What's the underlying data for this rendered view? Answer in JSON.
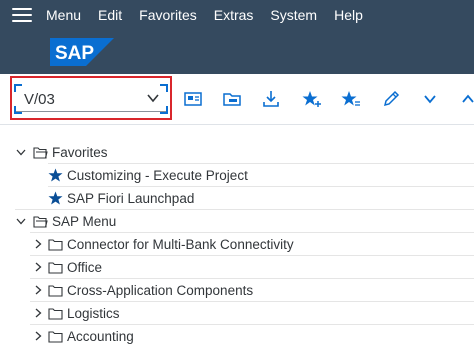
{
  "menubar": {
    "items": [
      {
        "label": "Menu"
      },
      {
        "label": "Edit"
      },
      {
        "label": "Favorites"
      },
      {
        "label": "Extras"
      },
      {
        "label": "System"
      },
      {
        "label": "Help"
      }
    ]
  },
  "logo": {
    "text": "SAP",
    "color": "#0a6ed1"
  },
  "command_field": {
    "value": "V/03"
  },
  "toolbar": {
    "icons": [
      "display-user-menu-icon",
      "display-sap-menu-icon",
      "download-icon",
      "add-favorite-icon",
      "favorite-settings-icon",
      "edit-icon",
      "chevron-down-icon",
      "chevron-up-icon"
    ],
    "accent": "#0a6ed1"
  },
  "tree": {
    "favorites": {
      "label": "Favorites",
      "items": [
        {
          "label": "Customizing - Execute Project"
        },
        {
          "label": "SAP Fiori Launchpad"
        }
      ]
    },
    "sap_menu": {
      "label": "SAP Menu",
      "folders": [
        {
          "label": "Connector for Multi-Bank Connectivity"
        },
        {
          "label": "Office"
        },
        {
          "label": "Cross-Application Components"
        },
        {
          "label": "Logistics"
        },
        {
          "label": "Accounting"
        }
      ]
    }
  },
  "colors": {
    "shell": "#354a5f",
    "highlight_border": "#d9262c",
    "tree_text": "#32363a"
  }
}
